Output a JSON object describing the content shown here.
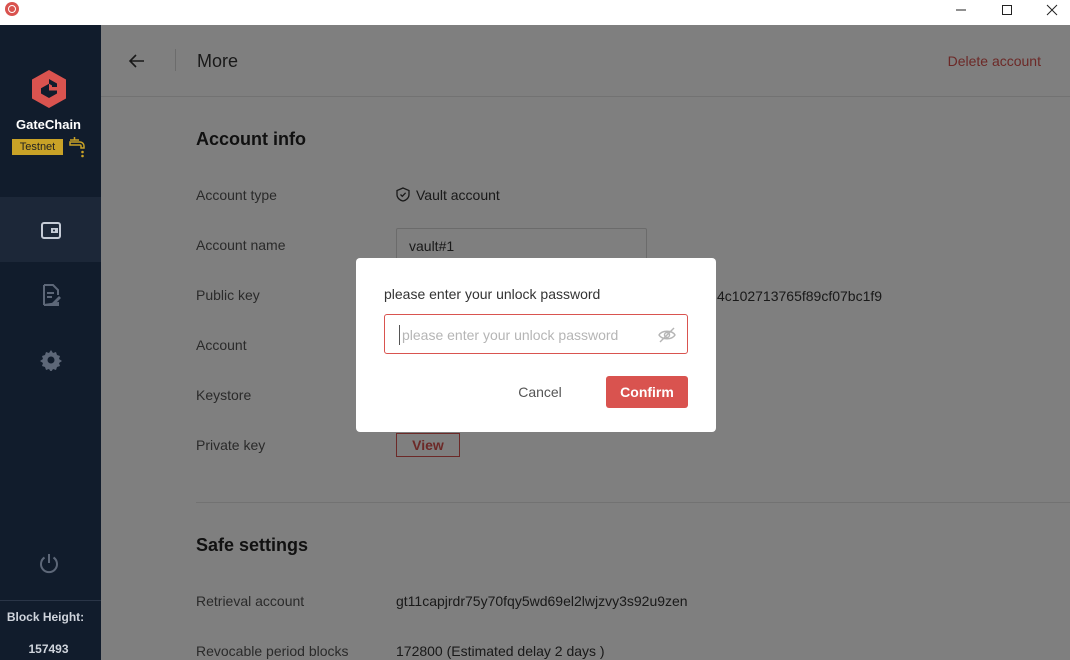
{
  "window": {
    "minimize_icon": "minimize-icon",
    "maximize_icon": "maximize-icon",
    "close_icon": "close-icon"
  },
  "sidebar": {
    "brand": "GateChain",
    "network_badge": "Testnet",
    "nav": [
      {
        "name": "wallet",
        "icon": "wallet-icon",
        "active": true
      },
      {
        "name": "transactions",
        "icon": "document-edit-icon",
        "active": false
      },
      {
        "name": "settings",
        "icon": "gear-icon",
        "active": false
      }
    ],
    "block_height_label": "Block Height:",
    "block_height_value": "157493"
  },
  "header": {
    "title": "More",
    "delete_label": "Delete account"
  },
  "account_info": {
    "title": "Account info",
    "type_label": "Account type",
    "type_value": "Vault account",
    "name_label": "Account name",
    "name_value": "vault#1",
    "pubkey_label": "Public key",
    "pubkey_visible_tail": "4c102713765f89cf07bc1f9",
    "account_label": "Account",
    "keystore_label": "Keystore",
    "privkey_label": "Private key",
    "view_label": "View"
  },
  "safe_settings": {
    "title": "Safe settings",
    "retrieval_label": "Retrieval account",
    "retrieval_value": "gt11capjrdr75y70fqy5wd69el2lwjzvy3s92u9zen",
    "revocable_label": "Revocable period blocks",
    "revocable_value": "172800 (Estimated delay 2 days )"
  },
  "modal": {
    "title": "please enter your unlock password",
    "placeholder": "please enter your unlock password",
    "value": "",
    "cancel_label": "Cancel",
    "confirm_label": "Confirm"
  },
  "colors": {
    "accent": "#d9534f",
    "sidebar_bg": "#111c2c",
    "badge": "#c9a227"
  }
}
